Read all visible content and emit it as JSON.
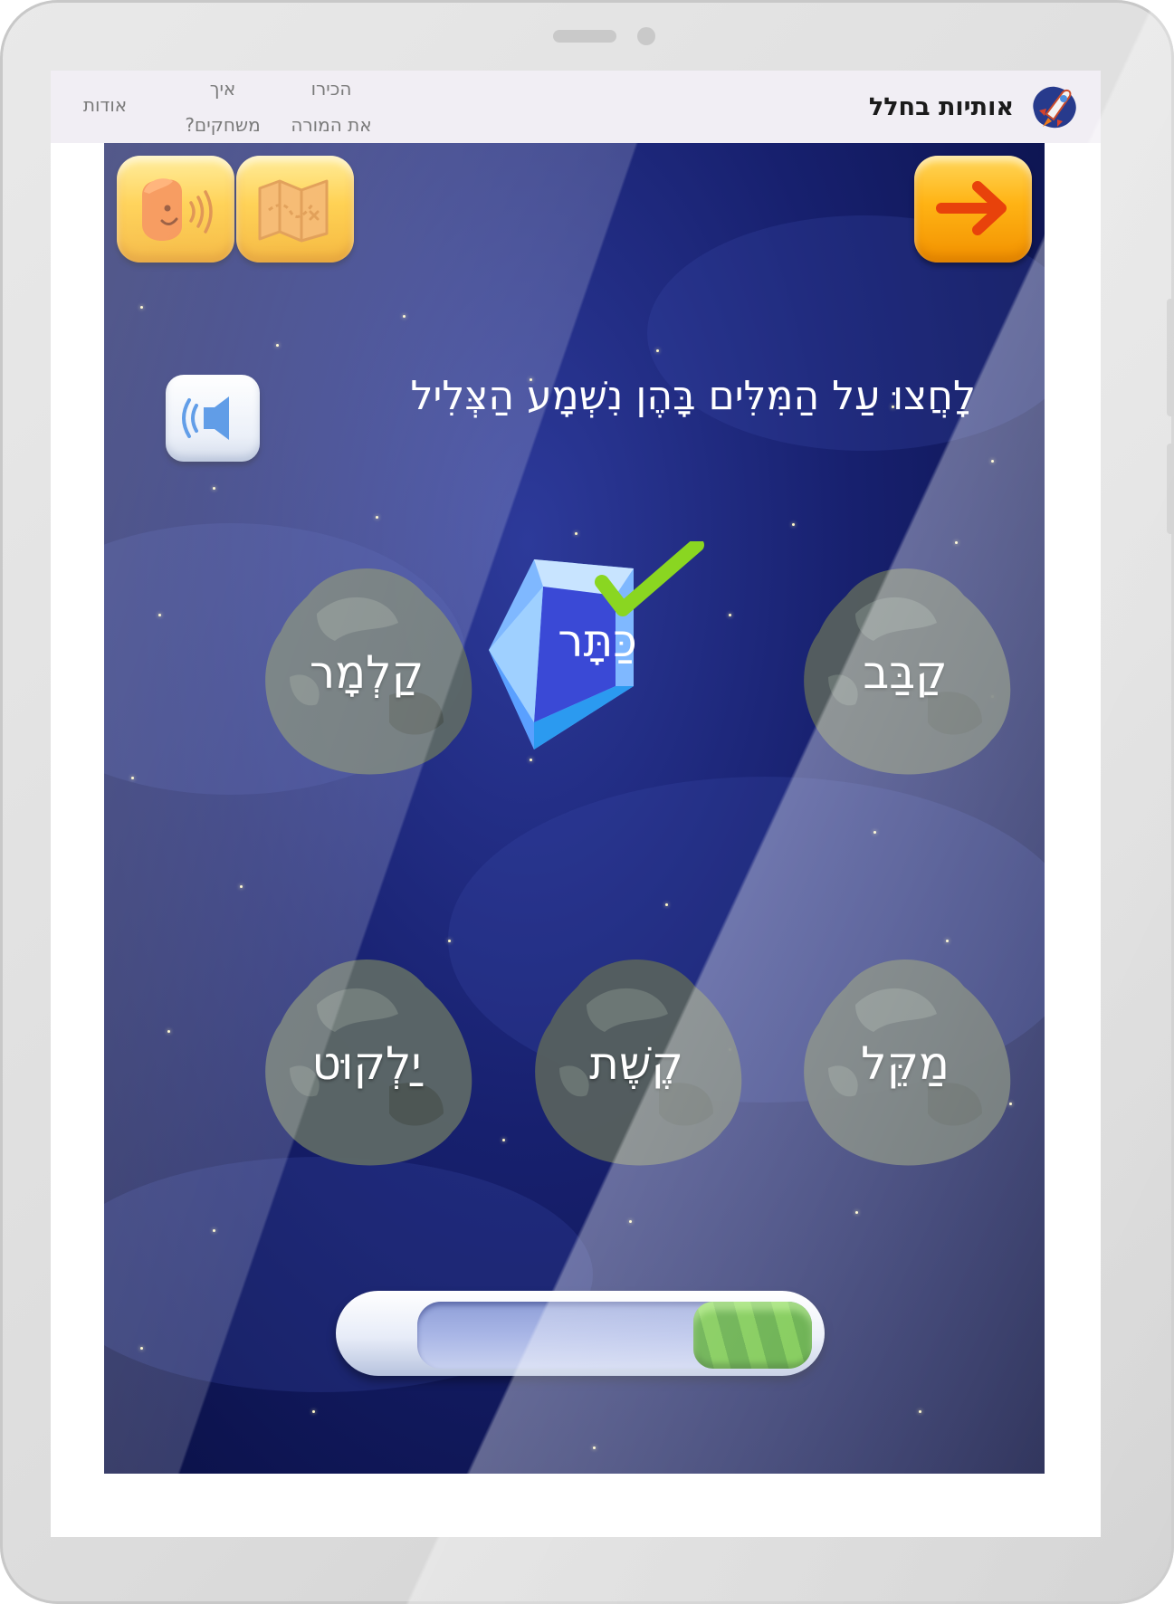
{
  "site": {
    "brand_name": "אותיות בחלל",
    "nav": {
      "about": "אודות",
      "how_to_play_line1": "איך",
      "how_to_play_line2": "משחקים?",
      "meet_teacher_line1": "הכירו",
      "meet_teacher_line2": "את המורה"
    }
  },
  "game": {
    "instruction": "לָחֲצוּ עַל הַמִּלִּים בָּהֶן נִשְׁמָע הַצְּלִיל",
    "buttons": {
      "next": "arrow-right-icon",
      "map": "map-icon",
      "speak": "speaking-face-icon",
      "sound": "speaker-icon"
    },
    "words": [
      {
        "id": "kaneve",
        "text": "קַבַּב",
        "state": "rock"
      },
      {
        "id": "keter",
        "text": "כַּתָּר",
        "state": "gem-correct"
      },
      {
        "id": "kalmar",
        "text": "קַלְמָר",
        "state": "rock"
      },
      {
        "id": "makel",
        "text": "מַקֵּל",
        "state": "rock"
      },
      {
        "id": "keshet",
        "text": "קֶשֶׁת",
        "state": "rock"
      },
      {
        "id": "yalkut",
        "text": "יַלְקוּט",
        "state": "rock"
      }
    ],
    "progress": 0.3,
    "colors": {
      "accent_yellow": "#ffc421",
      "space_blue": "#17206e",
      "check_green": "#8ad621",
      "progress_green": "#4fad22"
    }
  }
}
